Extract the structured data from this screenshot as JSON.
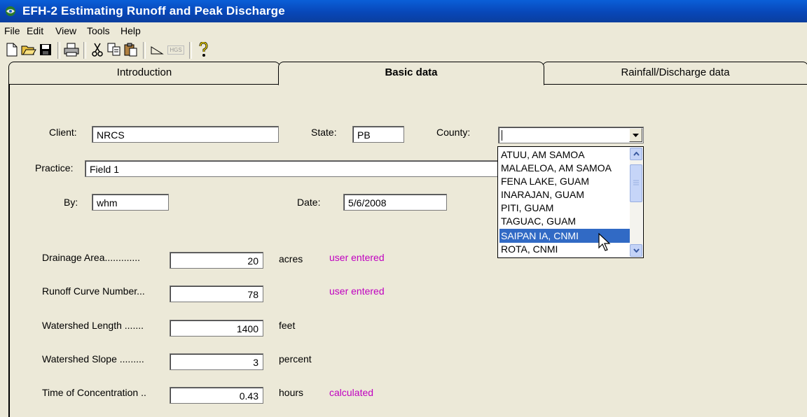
{
  "window": {
    "title": "EFH-2  Estimating Runoff and Peak Discharge"
  },
  "menu": [
    "File",
    "Edit",
    "View",
    "Tools",
    "Help"
  ],
  "toolbar": {
    "icons": [
      "new-icon",
      "open-icon",
      "save-icon",
      "print-icon",
      "cut-icon",
      "copy-icon",
      "paste-icon",
      "slope-icon",
      "hgs-icon",
      "help-icon"
    ],
    "hgs_label": "HGS"
  },
  "tabs": [
    {
      "label": "Introduction",
      "active": false
    },
    {
      "label": "Basic data",
      "active": true
    },
    {
      "label": "Rainfall/Discharge data",
      "active": false
    }
  ],
  "form": {
    "client_label": "Client:",
    "client_value": "NRCS",
    "state_label": "State:",
    "state_value": "PB",
    "county_label": "County:",
    "county_value": "",
    "practice_label": "Practice:",
    "practice_value": "Field 1",
    "by_label": "By:",
    "by_value": "whm",
    "date_label": "Date:",
    "date_value": "5/6/2008"
  },
  "params": [
    {
      "label": "Drainage Area.............",
      "value": "20",
      "unit": "acres",
      "note": "user entered"
    },
    {
      "label": "Runoff Curve Number...",
      "value": "78",
      "unit": "",
      "note": "user entered"
    },
    {
      "label": "Watershed Length .......",
      "value": "1400",
      "unit": "feet",
      "note": ""
    },
    {
      "label": "Watershed Slope .........",
      "value": "3",
      "unit": "percent",
      "note": ""
    },
    {
      "label": "Time of Concentration ..",
      "value": "0.43",
      "unit": "hours",
      "note": "calculated"
    }
  ],
  "county_dropdown": {
    "options": [
      "ATUU, AM SAMOA",
      "MALAELOA, AM SAMOA",
      "FENA LAKE, GUAM",
      "INARAJAN, GUAM",
      "PITI, GUAM",
      "TAGUAC, GUAM",
      "SAIPAN IA, CNMI",
      "ROTA, CNMI"
    ],
    "selected_index": 6
  },
  "colors": {
    "title_bar": "#0a5fd8",
    "selection": "#316ac5",
    "note_text": "#c000c0"
  }
}
